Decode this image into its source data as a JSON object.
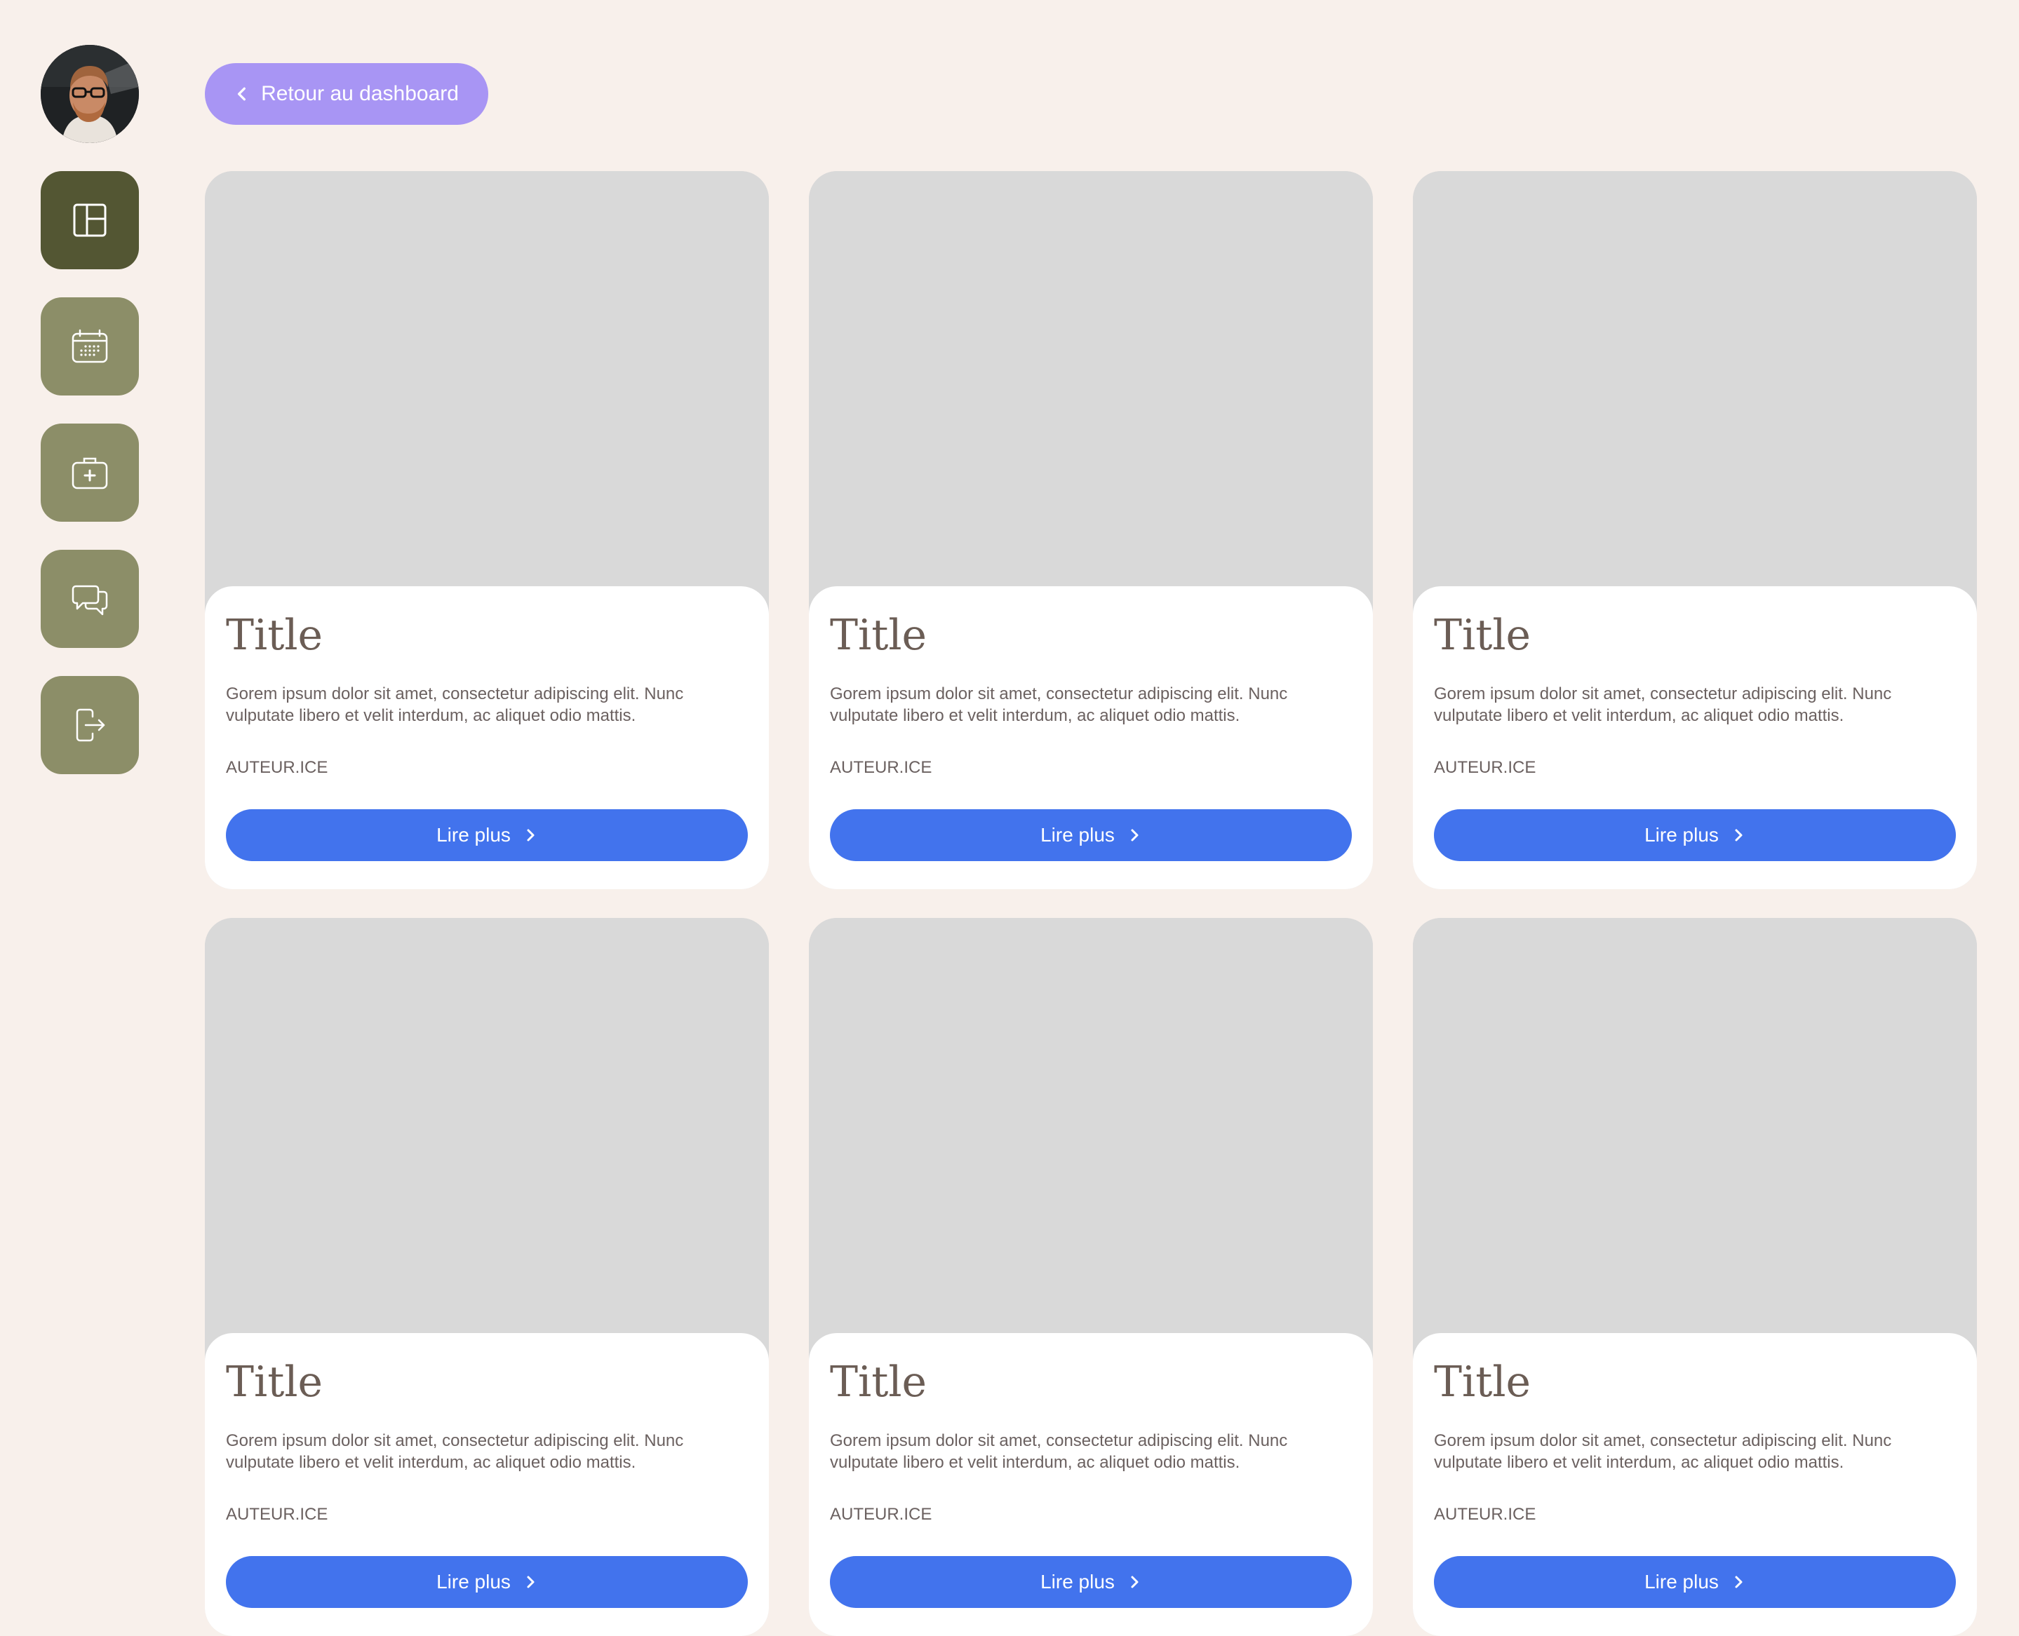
{
  "colors": {
    "background": "#f8f0eb",
    "nav_active": "#535633",
    "nav_default": "#8c8e68",
    "back_button": "#a895f4",
    "primary_button": "#4273ed",
    "image_placeholder": "#d9d9d9",
    "title_text": "#6b5d55"
  },
  "sidebar": {
    "avatar": "profile-photo",
    "items": [
      {
        "name": "dashboard",
        "icon": "layout-icon",
        "active": true
      },
      {
        "name": "calendar",
        "icon": "calendar-icon",
        "active": false
      },
      {
        "name": "medical",
        "icon": "medical-kit-icon",
        "active": false
      },
      {
        "name": "messages",
        "icon": "chat-bubbles-icon",
        "active": false
      },
      {
        "name": "logout",
        "icon": "logout-icon",
        "active": false
      }
    ]
  },
  "header": {
    "back_label": "Retour au dashboard",
    "back_icon": "chevron-left-icon"
  },
  "cards": [
    {
      "title": "Title",
      "text": "Gorem ipsum dolor sit amet, consectetur adipiscing elit. Nunc vulputate libero et velit interdum, ac aliquet odio mattis.",
      "author": "AUTEUR.ICE",
      "button_label": "Lire plus"
    },
    {
      "title": "Title",
      "text": "Gorem ipsum dolor sit amet, consectetur adipiscing elit. Nunc vulputate libero et velit interdum, ac aliquet odio mattis.",
      "author": "AUTEUR.ICE",
      "button_label": "Lire plus"
    },
    {
      "title": "Title",
      "text": "Gorem ipsum dolor sit amet, consectetur adipiscing elit. Nunc vulputate libero et velit interdum, ac aliquet odio mattis.",
      "author": "AUTEUR.ICE",
      "button_label": "Lire plus"
    },
    {
      "title": "Title",
      "text": "Gorem ipsum dolor sit amet, consectetur adipiscing elit. Nunc vulputate libero et velit interdum, ac aliquet odio mattis.",
      "author": "AUTEUR.ICE",
      "button_label": "Lire plus"
    },
    {
      "title": "Title",
      "text": "Gorem ipsum dolor sit amet, consectetur adipiscing elit. Nunc vulputate libero et velit interdum, ac aliquet odio mattis.",
      "author": "AUTEUR.ICE",
      "button_label": "Lire plus"
    },
    {
      "title": "Title",
      "text": "Gorem ipsum dolor sit amet, consectetur adipiscing elit. Nunc vulputate libero et velit interdum, ac aliquet odio mattis.",
      "author": "AUTEUR.ICE",
      "button_label": "Lire plus"
    }
  ]
}
